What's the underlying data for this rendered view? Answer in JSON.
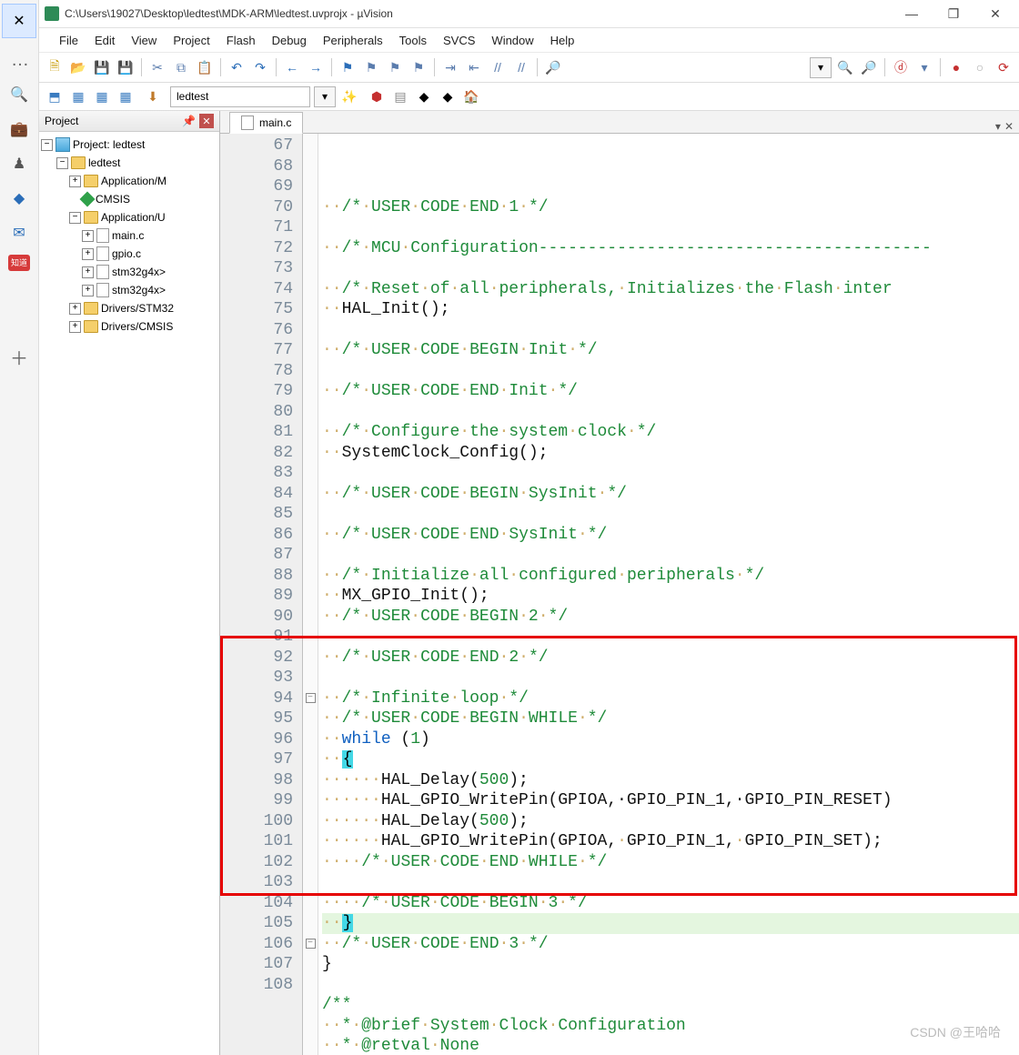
{
  "title": "C:\\Users\\19027\\Desktop\\ledtest\\MDK-ARM\\ledtest.uvprojx - µVision",
  "menu": [
    "File",
    "Edit",
    "View",
    "Project",
    "Flash",
    "Debug",
    "Peripherals",
    "Tools",
    "SVCS",
    "Window",
    "Help"
  ],
  "target_name": "ledtest",
  "project_panel_title": "Project",
  "tree": {
    "root": "Project: ledtest",
    "target": "ledtest",
    "grp1": "Application/M",
    "cmsis": "CMSIS",
    "grp2": "Application/U",
    "f1": "main.c",
    "f2": "gpio.c",
    "f3": "stm32g4x>",
    "f4": "stm32g4x>",
    "drv1": "Drivers/STM32",
    "drv2": "Drivers/CMSIS"
  },
  "tab_file": "main.c",
  "lines": [
    {
      "n": 67,
      "pad": "··",
      "t": "/*·USER·CODE·END·1·*/",
      "cls": "cmt"
    },
    {
      "n": 68,
      "pad": "",
      "t": "",
      "cls": ""
    },
    {
      "n": 69,
      "pad": "··",
      "t": "/*·MCU·Configuration----------------------------------------",
      "cls": "cmt"
    },
    {
      "n": 70,
      "pad": "",
      "t": "",
      "cls": ""
    },
    {
      "n": 71,
      "pad": "··",
      "t": "/*·Reset·of·all·peripherals,·Initializes·the·Flash·inter",
      "cls": "cmt"
    },
    {
      "n": 72,
      "pad": "··",
      "t": "HAL_Init();",
      "cls": ""
    },
    {
      "n": 73,
      "pad": "",
      "t": "",
      "cls": ""
    },
    {
      "n": 74,
      "pad": "··",
      "t": "/*·USER·CODE·BEGIN·Init·*/",
      "cls": "cmt"
    },
    {
      "n": 75,
      "pad": "",
      "t": "",
      "cls": ""
    },
    {
      "n": 76,
      "pad": "··",
      "t": "/*·USER·CODE·END·Init·*/",
      "cls": "cmt"
    },
    {
      "n": 77,
      "pad": "",
      "t": "",
      "cls": ""
    },
    {
      "n": 78,
      "pad": "··",
      "t": "/*·Configure·the·system·clock·*/",
      "cls": "cmt"
    },
    {
      "n": 79,
      "pad": "··",
      "t": "SystemClock_Config();",
      "cls": ""
    },
    {
      "n": 80,
      "pad": "",
      "t": "",
      "cls": ""
    },
    {
      "n": 81,
      "pad": "··",
      "t": "/*·USER·CODE·BEGIN·SysInit·*/",
      "cls": "cmt"
    },
    {
      "n": 82,
      "pad": "",
      "t": "",
      "cls": ""
    },
    {
      "n": 83,
      "pad": "··",
      "t": "/*·USER·CODE·END·SysInit·*/",
      "cls": "cmt"
    },
    {
      "n": 84,
      "pad": "",
      "t": "",
      "cls": ""
    },
    {
      "n": 85,
      "pad": "··",
      "t": "/*·Initialize·all·configured·peripherals·*/",
      "cls": "cmt"
    },
    {
      "n": 86,
      "pad": "··",
      "t": "MX_GPIO_Init();",
      "cls": ""
    },
    {
      "n": 87,
      "pad": "··",
      "t": "/*·USER·CODE·BEGIN·2·*/",
      "cls": "cmt"
    },
    {
      "n": 88,
      "pad": "",
      "t": "",
      "cls": ""
    },
    {
      "n": 89,
      "pad": "··",
      "t": "/*·USER·CODE·END·2·*/",
      "cls": "cmt"
    },
    {
      "n": 90,
      "pad": "",
      "t": "",
      "cls": ""
    },
    {
      "n": 91,
      "pad": "··",
      "t": "/*·Infinite·loop·*/",
      "cls": "cmt"
    },
    {
      "n": 92,
      "pad": "··",
      "t": "/*·USER·CODE·BEGIN·WHILE·*/",
      "cls": "cmt"
    },
    {
      "n": 93,
      "pad": "··",
      "t": "",
      "cls": "",
      "html": "<span class='kw'>while</span> (<span class='num'>1</span>)"
    },
    {
      "n": 94,
      "pad": "··",
      "t": "",
      "cls": "",
      "html": "<span class='hlbrace'>{</span>",
      "fold": "⊟"
    },
    {
      "n": 95,
      "pad": "······",
      "t": "",
      "cls": "",
      "html": "HAL_Delay(<span class='num'>500</span>);"
    },
    {
      "n": 96,
      "pad": "······",
      "t": "",
      "cls": "",
      "html": "HAL_GPIO_WritePin(GPIOA,·GPIO_PIN_1,·GPIO_PIN_RESET)"
    },
    {
      "n": 97,
      "pad": "······",
      "t": "",
      "cls": "",
      "html": "HAL_Delay(<span class='num'>500</span>);"
    },
    {
      "n": 98,
      "pad": "······",
      "t": "HAL_GPIO_WritePin(GPIOA,·GPIO_PIN_1,·GPIO_PIN_SET);",
      "cls": ""
    },
    {
      "n": 99,
      "pad": "····",
      "t": "/*·USER·CODE·END·WHILE·*/",
      "cls": "cmt"
    },
    {
      "n": 100,
      "pad": "",
      "t": "",
      "cls": ""
    },
    {
      "n": 101,
      "pad": "····",
      "t": "/*·USER·CODE·BEGIN·3·*/",
      "cls": "cmt"
    },
    {
      "n": 102,
      "pad": "··",
      "t": "",
      "cls": "",
      "html": "<span class='hlbrace'>}</span>",
      "hl": true
    },
    {
      "n": 103,
      "pad": "··",
      "t": "/*·USER·CODE·END·3·*/",
      "cls": "cmt"
    },
    {
      "n": 104,
      "pad": "",
      "t": "}",
      "cls": ""
    },
    {
      "n": 105,
      "pad": "",
      "t": "",
      "cls": ""
    },
    {
      "n": 106,
      "pad": "",
      "t": "/**",
      "cls": "cmt",
      "fold": "⊟"
    },
    {
      "n": 107,
      "pad": "··",
      "t": "*·@brief·System·Clock·Configuration",
      "cls": "cmt"
    },
    {
      "n": 108,
      "pad": "··",
      "t": "*·@retval·None",
      "cls": "cmt"
    }
  ],
  "watermark": "CSDN @王哈哈"
}
